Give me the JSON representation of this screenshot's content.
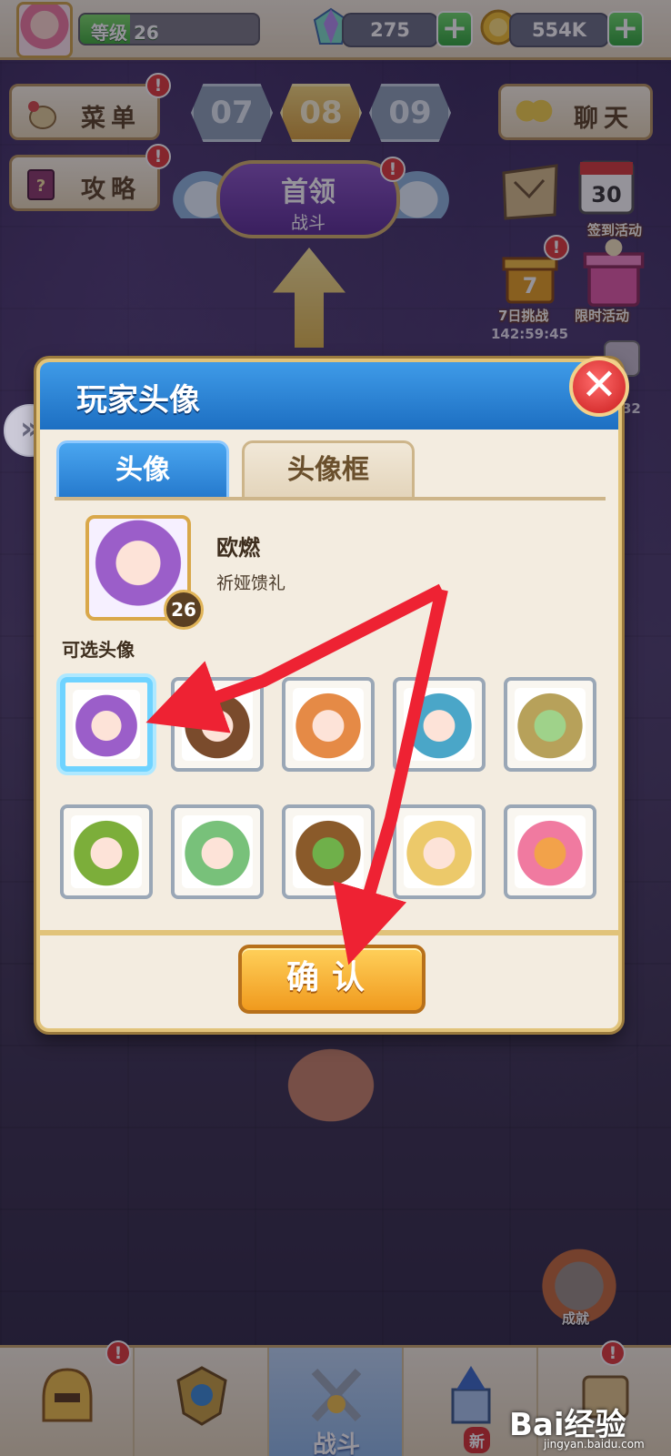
{
  "top_bar": {
    "level_label": "等级 26",
    "level_progress": 0.28,
    "gems": "275",
    "gold": "554K",
    "plus_label": "+"
  },
  "left_menu": {
    "menu_label": "菜单",
    "guide_label": "攻略",
    "alert": "!"
  },
  "stages": [
    "07",
    "08",
    "09"
  ],
  "boss": {
    "title": "首领",
    "subtitle": "战斗"
  },
  "right_menu": {
    "chat_label": "聊天",
    "event_seven_day": "7日挑战",
    "event_limited": "限时活动",
    "event_sign_in": "签到活动",
    "timer": "142:59:45",
    "partial_counter": "32"
  },
  "modal": {
    "title": "玩家头像",
    "close_label": "✕",
    "tabs": [
      "头像",
      "头像框"
    ],
    "current": {
      "name": "欧燃",
      "source": "祈娅馈礼",
      "level": "26"
    },
    "selectable_label": "可选头像",
    "confirm_label": "确认"
  },
  "avatars": [
    {
      "id": "purple-horned-girl",
      "colors": [
        "#9b5ec9",
        "#fde3d8"
      ],
      "selected": true
    },
    {
      "id": "brown-hair-girl",
      "colors": [
        "#7a4b2c",
        "#fde3d8"
      ],
      "selected": false
    },
    {
      "id": "orange-hair-girl",
      "colors": [
        "#e58a46",
        "#fde3d8"
      ],
      "selected": false
    },
    {
      "id": "blue-hair-boy",
      "colors": [
        "#4aa6c8",
        "#fde3d8"
      ],
      "selected": false
    },
    {
      "id": "frog-hat-girl",
      "colors": [
        "#b7a15a",
        "#9fd28a"
      ],
      "selected": false
    },
    {
      "id": "green-hood-girl",
      "colors": [
        "#7cae3a",
        "#fde3d8"
      ],
      "selected": false
    },
    {
      "id": "green-hair-girl",
      "colors": [
        "#78c17a",
        "#fde3d8"
      ],
      "selected": false
    },
    {
      "id": "mushroom-creature",
      "colors": [
        "#8a5a2a",
        "#6fb04a"
      ],
      "selected": false
    },
    {
      "id": "blonde-girl",
      "colors": [
        "#ecc96a",
        "#fde3d8"
      ],
      "selected": false
    },
    {
      "id": "pink-fox-girl",
      "colors": [
        "#f07aa0",
        "#f2a24a"
      ],
      "selected": false
    }
  ],
  "bottom_nav": {
    "items": [
      "",
      "",
      "战斗",
      "",
      ""
    ],
    "new_badge": "新"
  },
  "watermark": {
    "brand": "Bai经验",
    "url": "jingyan.baidu.com"
  },
  "achievement_label": "成就",
  "colors": {
    "header_blue": "#2478cc",
    "confirm_orange": "#f09a1e",
    "arrow_red": "#ee2233",
    "selected_cyan": "#6fd3ff"
  }
}
